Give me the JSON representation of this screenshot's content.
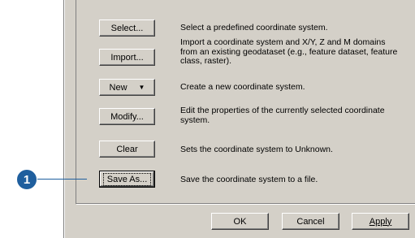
{
  "buttons": {
    "select": "Select...",
    "import": "Import...",
    "new": "New",
    "new_arrow": "▼",
    "modify": "Modify...",
    "clear": "Clear",
    "save_as": "Save As..."
  },
  "descriptions": {
    "select": "Select a predefined coordinate system.",
    "import": "Import a coordinate system and X/Y, Z and M domains from an existing geodataset (e.g., feature dataset, feature class, raster).",
    "new": "Create a new coordinate system.",
    "modify": "Edit the properties of the currently selected coordinate system.",
    "clear": "Sets the coordinate system to Unknown.",
    "save_as": "Save the coordinate system to a file."
  },
  "callout": {
    "number": "1",
    "color": "#1f5f9e"
  },
  "footer": {
    "ok": "OK",
    "cancel": "Cancel",
    "apply": "Apply"
  }
}
